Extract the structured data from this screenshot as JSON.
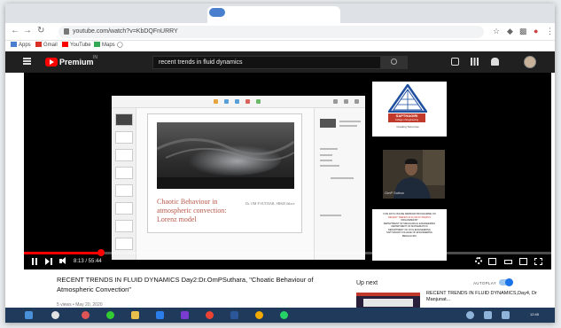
{
  "browser": {
    "url": "youtube.com/watch?v=KbDQFnURRY",
    "bookmarks": [
      "Apps",
      "Gmail",
      "YouTube",
      "Maps"
    ]
  },
  "youtube": {
    "logo": "Premium",
    "logo_sup": "IN",
    "search_value": "recent trends in fluid dynamics"
  },
  "slide": {
    "title": "Chaotic Behaviour in atmospheric convection: Lorenz model",
    "author": "Dr. OM P SUTHAR, SRKB Jalore"
  },
  "webcam": {
    "college_name": "SAPTHAGIRI",
    "college_sub": "College of Engineering",
    "college_tag": "Creating Tomorrow",
    "presenter": "OmP Suthar",
    "info_lines": [
      "FIVE DAYS ONLINE WEBINAR PROGRAMME ON",
      "RECENT TRENDS IN FLUID DYNAMICS",
      "ORGANIZED BY",
      "DEPARTMENT OF MECHANICAL ENGINEERING",
      "DEPARTMENT OF MATHEMATICS",
      "DEPARTMENT OF CIVIL ENGINEERING",
      "SAPTHAGIRI COLLEGE OF ENGINEERING",
      "BENGALURU"
    ]
  },
  "player": {
    "time": "8:13 / 55:44",
    "progress": 0.147
  },
  "video": {
    "title": "RECENT TRENDS IN FLUID DYNAMICS Day2:Dr.OmPSuthara, \"Choatic Behaviour of Atmospheric Convection\"",
    "meta": "5 views • May 20, 2020"
  },
  "sidebar": {
    "up_next": "Up next",
    "autoplay": "AUTOPLAY",
    "next_title": "RECENT TRENDS IN FLUID DYNAMICS,Day4, Dr Manjunat..."
  },
  "taskbar": {
    "time": "12:45"
  },
  "colors": {
    "youtube_red": "#ff0000",
    "header_bg": "#202020",
    "slide_title": "#b8574a"
  }
}
